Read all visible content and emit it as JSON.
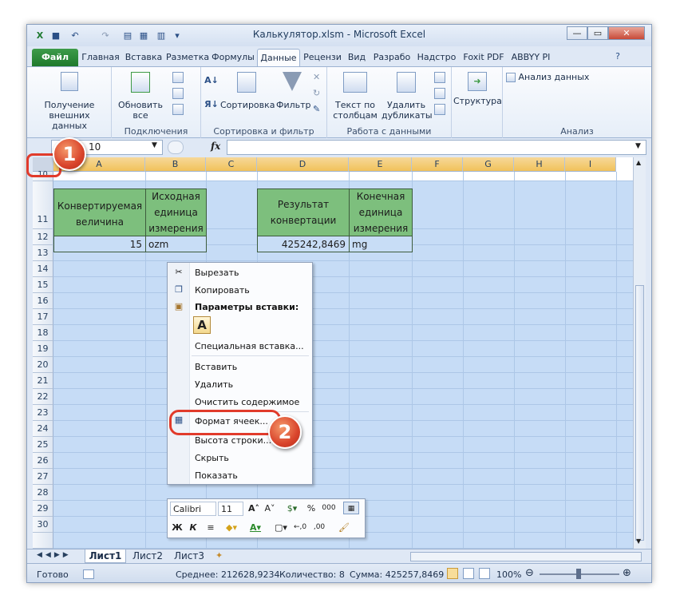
{
  "window": {
    "title": "Калькулятор.xlsm - Microsoft Excel"
  },
  "tabs": [
    "Файл",
    "Главная",
    "Вставка",
    "Разметка",
    "Формулы",
    "Данные",
    "Рецензи",
    "Вид",
    "Разрабо",
    "Надстро",
    "Foxit PDF",
    "ABBYY PI"
  ],
  "ribbon": {
    "get_external": "Получение внешних данных",
    "refresh_all": "Обновить все",
    "group_connections": "Подключения",
    "sort": "Сортировка",
    "filter": "Фильтр",
    "group_sort": "Сортировка и фильтр",
    "text_to_columns": "Текст по столбцам",
    "remove_duplicates": "Удалить дубликаты",
    "group_data": "Работа с данными",
    "outline": "Структура",
    "data_analysis": "Анализ данных",
    "group_analysis": "Анализ"
  },
  "formula_bar": {
    "name_box": "10",
    "fx": "fx",
    "value": ""
  },
  "columns": [
    "A",
    "B",
    "C",
    "D",
    "E",
    "F",
    "G",
    "H",
    "I"
  ],
  "rows": [
    "10",
    "11",
    "12",
    "13",
    "14",
    "15",
    "16",
    "17",
    "18",
    "19",
    "20",
    "21",
    "22",
    "23",
    "24",
    "25",
    "26",
    "27",
    "28",
    "29",
    "30"
  ],
  "table1": {
    "header_a": "Конвертируемая величина",
    "header_b": "Исходная единица измерения",
    "value_a": "15",
    "value_b": "ozm"
  },
  "table2": {
    "header_d": "Результат конвертации",
    "header_e": "Конечная единица измерения",
    "value_d": "425242,8469",
    "value_e": "mg"
  },
  "context_menu": {
    "cut": "Вырезать",
    "copy": "Копировать",
    "paste_options": "Параметры вставки:",
    "paste_icon": "A",
    "paste_special": "Специальная вставка...",
    "insert": "Вставить",
    "delete": "Удалить",
    "clear": "Очистить содержимое",
    "format_cells": "Формат ячеек...",
    "row_height": "Высота строки...",
    "hide": "Скрыть",
    "show": "Показать"
  },
  "mini_toolbar": {
    "font": "Calibri",
    "size": "11",
    "bold": "Ж",
    "italic": "К"
  },
  "sheets": [
    "Лист1",
    "Лист2",
    "Лист3"
  ],
  "status": {
    "ready": "Готово",
    "average": "Среднее: 212628,9234",
    "count": "Количество: 8",
    "sum": "Сумма: 425257,8469",
    "zoom": "100%"
  },
  "annotations": {
    "badge1": "1",
    "badge2": "2"
  },
  "colors": {
    "header_green": "#7dbf7d",
    "selection_blue": "#c6dcf6",
    "callout_red": "#d9442c",
    "file_tab": "#2f8b3d"
  }
}
